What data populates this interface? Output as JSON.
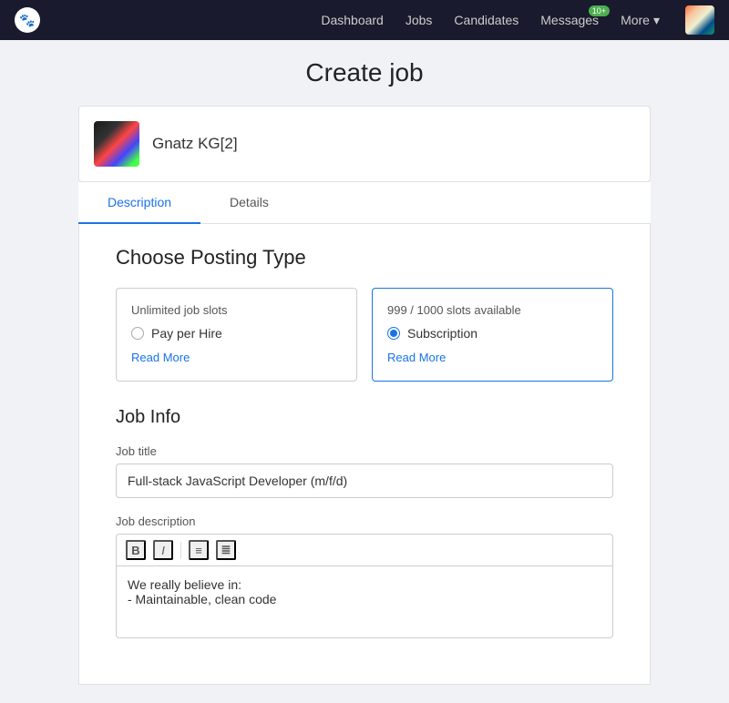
{
  "nav": {
    "logo_text": "🐾",
    "links": [
      {
        "id": "dashboard",
        "label": "Dashboard",
        "badge": null
      },
      {
        "id": "jobs",
        "label": "Jobs",
        "badge": null
      },
      {
        "id": "candidates",
        "label": "Candidates",
        "badge": null
      },
      {
        "id": "messages",
        "label": "Messages",
        "badge": "10+"
      }
    ],
    "more_label": "More",
    "more_chevron": "▾"
  },
  "page": {
    "title": "Create job"
  },
  "company": {
    "name": "Gnatz KG[2]"
  },
  "tabs": [
    {
      "id": "description",
      "label": "Description",
      "active": true
    },
    {
      "id": "details",
      "label": "Details",
      "active": false
    }
  ],
  "posting": {
    "section_title": "Choose Posting Type",
    "options": [
      {
        "id": "pay-per-hire",
        "top_label": "Unlimited job slots",
        "radio_label": "Pay per Hire",
        "read_more": "Read More",
        "selected": false
      },
      {
        "id": "subscription",
        "top_label": "999 / 1000 slots available",
        "radio_label": "Subscription",
        "read_more": "Read More",
        "selected": true
      }
    ]
  },
  "job_info": {
    "section_title": "Job Info",
    "title_label": "Job title",
    "title_value": "Full-stack JavaScript Developer (m/f/d)",
    "description_label": "Job description",
    "toolbar": {
      "bold": "B",
      "italic": "I",
      "list_ul": "≡",
      "list_ol": "≣"
    },
    "editor_content_line1": "We really believe in:",
    "editor_content_line2": "- Maintainable, clean code"
  }
}
